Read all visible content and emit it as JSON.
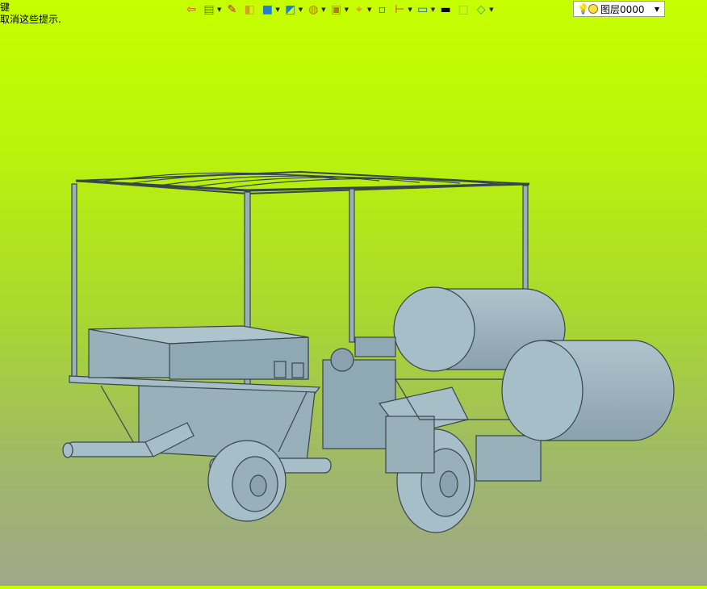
{
  "hint": {
    "line1": "键",
    "line2": "取消这些提示."
  },
  "toolbar": {
    "buttons": [
      {
        "name": "exit-icon",
        "glyph": "⇦",
        "color": "#d04a20",
        "dropdown": false
      },
      {
        "name": "layers-icon",
        "glyph": "▤",
        "color": "#3a8a3a",
        "dropdown": true
      },
      {
        "name": "pencil-icon",
        "glyph": "✎",
        "color": "#c02030",
        "dropdown": false
      },
      {
        "name": "box-icon",
        "glyph": "◧",
        "color": "#d8a020",
        "dropdown": false
      },
      {
        "name": "solid-box-icon",
        "glyph": "■",
        "color": "#1f7fd0",
        "dropdown": true
      },
      {
        "name": "view-cube-icon",
        "glyph": "◩",
        "color": "#1f7fd0",
        "dropdown": true
      },
      {
        "name": "render-sphere-icon",
        "glyph": "◍",
        "color": "#e05a10",
        "dropdown": true
      },
      {
        "name": "texture-icon",
        "glyph": "▣",
        "color": "#b07a20",
        "dropdown": true
      },
      {
        "name": "crosshair-icon",
        "glyph": "⌖",
        "color": "#e07010",
        "dropdown": true
      },
      {
        "name": "grid-icon",
        "glyph": "▫",
        "color": "#3a7a3a",
        "dropdown": false
      },
      {
        "name": "dimension-icon",
        "glyph": "⊢",
        "color": "#c04020",
        "dropdown": true
      },
      {
        "name": "monitor-icon",
        "glyph": "▭",
        "color": "#2060a0",
        "dropdown": true
      },
      {
        "name": "color-black-icon",
        "glyph": "▬",
        "color": "#000000",
        "dropdown": false
      },
      {
        "name": "color-swatch-icon",
        "glyph": "□",
        "color": "#7ab4e0",
        "dropdown": false
      },
      {
        "name": "plane-layer-icon",
        "glyph": "◇",
        "color": "#2a9ab0",
        "dropdown": true
      }
    ]
  },
  "layer": {
    "bulb_icon": "lightbulb-icon",
    "value": "图层0000"
  },
  "colors": {
    "model_fill": "#97b0ba",
    "model_fill_light": "#a6bec8",
    "model_stroke": "#38454c"
  }
}
